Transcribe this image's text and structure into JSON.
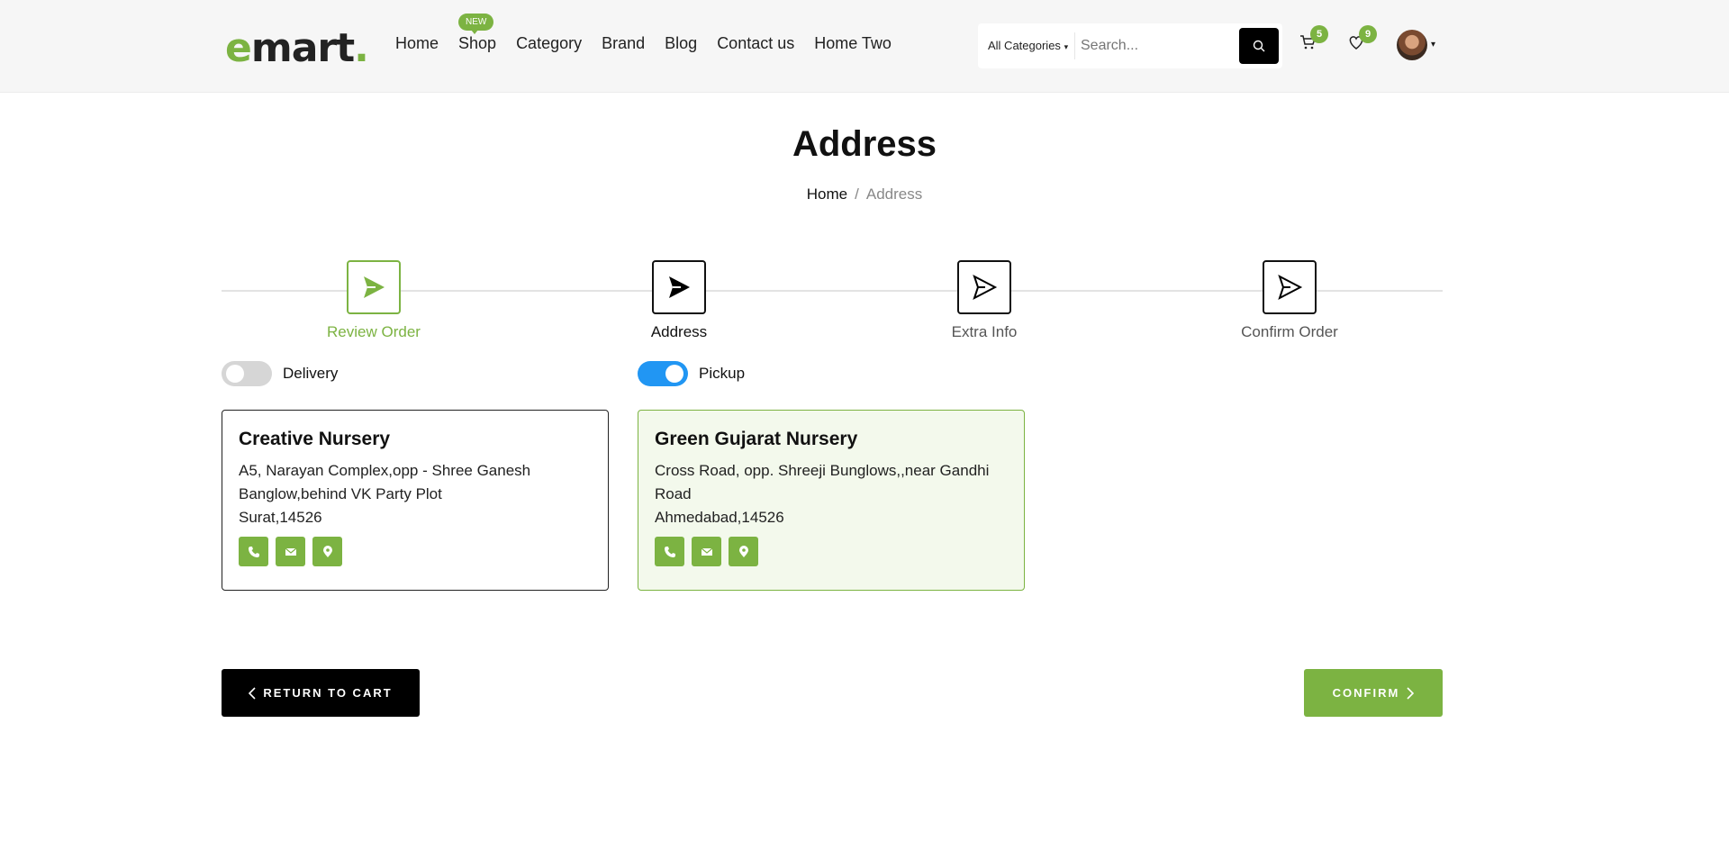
{
  "brand": {
    "logo_e": "e",
    "logo_rest": "mart",
    "logo_dot": ".",
    "accent": "#7cb342"
  },
  "nav": [
    {
      "label": "Home"
    },
    {
      "label": "Shop",
      "badge": "NEW"
    },
    {
      "label": "Category"
    },
    {
      "label": "Brand"
    },
    {
      "label": "Blog"
    },
    {
      "label": "Contact us"
    },
    {
      "label": "Home Two"
    }
  ],
  "search": {
    "category": "All Categories",
    "placeholder": "Search..."
  },
  "cart": {
    "count": "5",
    "icon": "cart-icon"
  },
  "wishlist": {
    "count": "9",
    "icon": "heart-icon"
  },
  "page": {
    "title": "Address"
  },
  "breadcrumb": {
    "home": "Home",
    "separator": "/",
    "current": "Address"
  },
  "steps": [
    {
      "label": "Review Order",
      "state": "done"
    },
    {
      "label": "Address",
      "state": "current"
    },
    {
      "label": "Extra Info",
      "state": "pending"
    },
    {
      "label": "Confirm Order",
      "state": "pending"
    }
  ],
  "delivery": {
    "label": "Delivery",
    "on": false
  },
  "pickup": {
    "label": "Pickup",
    "on": true,
    "color": "#2196f3"
  },
  "addresses": [
    {
      "name": "Creative Nursery",
      "line1": "A5, Narayan Complex,opp - Shree Ganesh Banglow,behind VK Party Plot",
      "line2": "Surat,14526",
      "selected": false
    },
    {
      "name": "Green Gujarat Nursery",
      "line1": "Cross Road, opp. Shreeji Bunglows,,near Gandhi Road",
      "line2": "Ahmedabad,14526",
      "selected": true
    }
  ],
  "actions": {
    "return_label": "RETURN TO CART",
    "confirm_label": "CONFIRM"
  }
}
